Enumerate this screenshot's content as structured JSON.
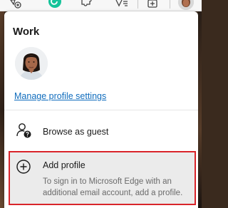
{
  "toolbar": {
    "icons": [
      "favorites-add-icon",
      "grammarly-icon",
      "extensions-icon",
      "favorites-icon",
      "collections-icon",
      "profile-avatar-icon"
    ]
  },
  "profile_menu": {
    "title": "Work",
    "manage_link": "Manage profile settings",
    "guest_label": "Browse as guest",
    "add_profile": {
      "label": "Add profile",
      "description": "To sign in to Microsoft Edge with an additional email account, add a profile."
    }
  },
  "colors": {
    "link": "#0f6cbd",
    "highlight_border": "#d9242a",
    "highlight_bg": "#ebebeb",
    "grammarly": "#15c39a"
  }
}
